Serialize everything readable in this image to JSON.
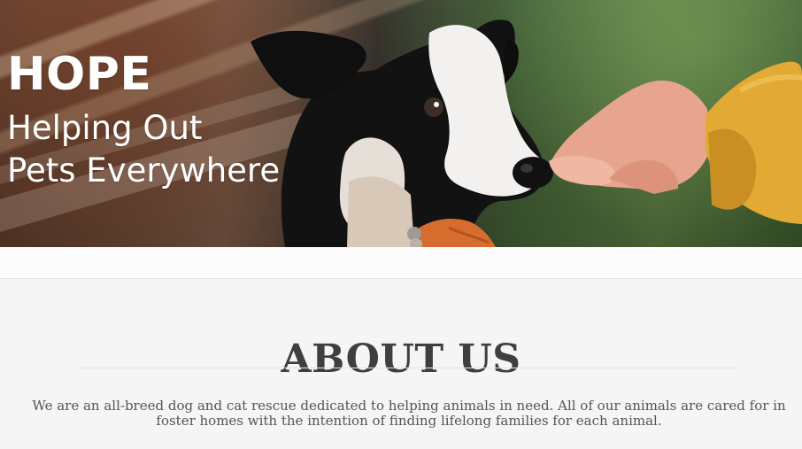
{
  "hero": {
    "title": "HOPE",
    "line_1": "Helping Out",
    "line_2": "Pets Everywhere"
  },
  "about": {
    "heading": "ABOUT US",
    "text": "We are an all-breed dog and cat rescue dedicated to helping animals in need. All of our animals are cared for in foster homes with the intention of finding lifelong families for each animal."
  }
}
